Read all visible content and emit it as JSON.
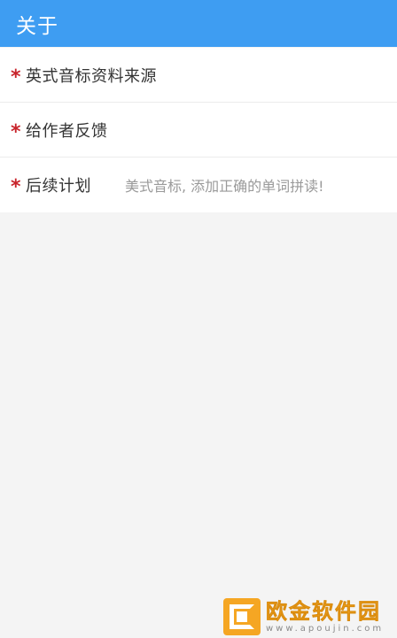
{
  "app_bar": {
    "title": "关于",
    "color": "#3e9df2"
  },
  "list": {
    "items": [
      {
        "marker": "*",
        "label": "英式音标资料来源",
        "description": ""
      },
      {
        "marker": "*",
        "label": "给作者反馈",
        "description": ""
      },
      {
        "marker": "*",
        "label": "后续计划",
        "description": "美式音标, 添加正确的单词拼读!"
      }
    ]
  },
  "watermark": {
    "name": "欧金软件园",
    "url": "www.apoujin.com"
  }
}
